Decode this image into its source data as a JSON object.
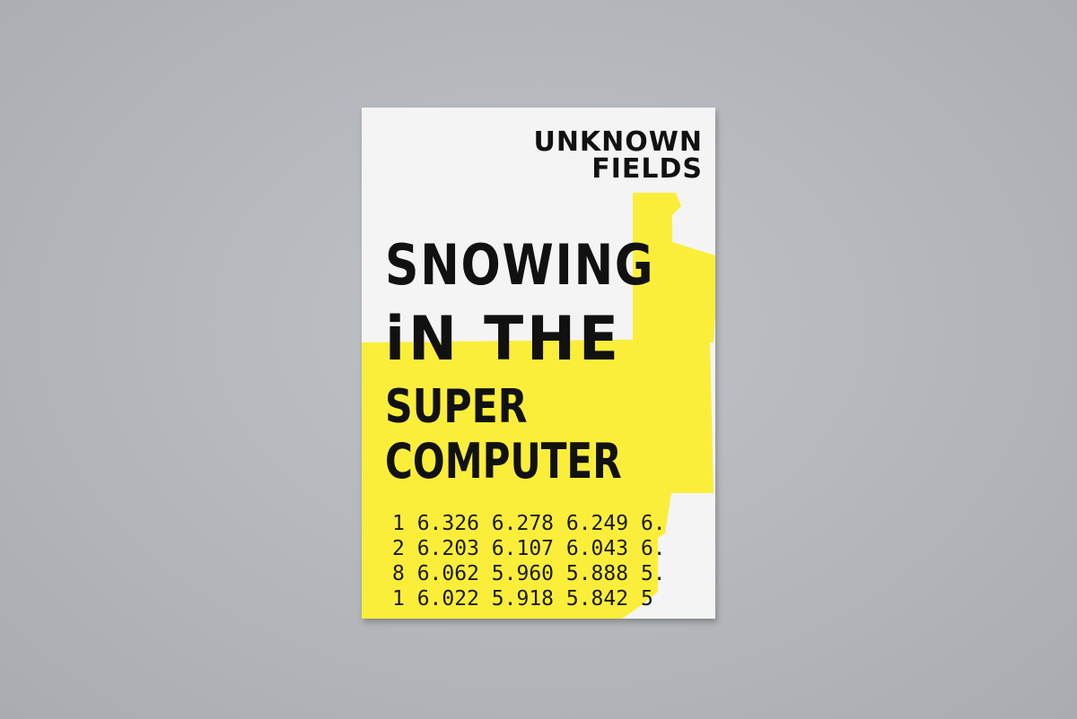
{
  "cover": {
    "brand": [
      "UNKNOWN",
      "FIELDS"
    ],
    "title_lines": [
      "SNOWING",
      "iN THE",
      "SUPER",
      "COMPUTER"
    ],
    "table_rows": [
      "1 6.326 6.278 6.249 6.",
      "2 6.203 6.107 6.043 6.",
      "8 6.062 5.960 5.888 5.",
      "1 6.022 5.918 5.842 5"
    ],
    "colors": {
      "yellow": "#fbee3a",
      "ink": "#111111",
      "paper": "#f4f4f4",
      "backdrop": "#b4b7bb"
    }
  }
}
